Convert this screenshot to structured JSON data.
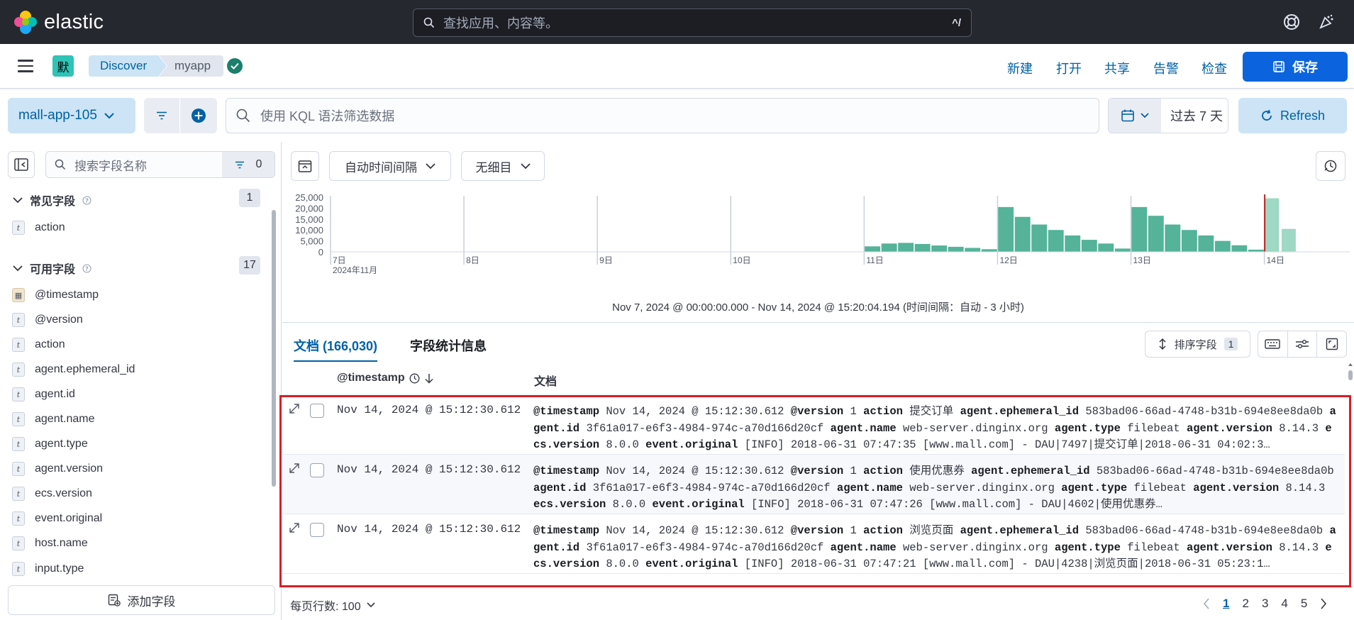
{
  "app": {
    "logo_text": "elastic",
    "search_placeholder": "查找应用、内容等。",
    "search_shortcut": "^/"
  },
  "nav": {
    "space_badge": "默",
    "breadcrumbs": [
      "Discover",
      "myapp"
    ],
    "links": [
      "新建",
      "打开",
      "共享",
      "告警",
      "检查"
    ],
    "save_label": "保存"
  },
  "query": {
    "dataview": "mall-app-105",
    "kql_placeholder": "使用 KQL 语法筛选数据",
    "date_label": "过去 7 天",
    "refresh_label": "Refresh"
  },
  "sidebar": {
    "search_placeholder": "搜索字段名称",
    "filter_count": "0",
    "popular": {
      "title": "常见字段",
      "count": "1",
      "fields": [
        {
          "type": "t",
          "name": "action"
        }
      ]
    },
    "available": {
      "title": "可用字段",
      "count": "17",
      "fields": [
        {
          "type": "date",
          "name": "@timestamp"
        },
        {
          "type": "t",
          "name": "@version"
        },
        {
          "type": "t",
          "name": "action"
        },
        {
          "type": "t",
          "name": "agent.ephemeral_id"
        },
        {
          "type": "t",
          "name": "agent.id"
        },
        {
          "type": "t",
          "name": "agent.name"
        },
        {
          "type": "t",
          "name": "agent.type"
        },
        {
          "type": "t",
          "name": "agent.version"
        },
        {
          "type": "t",
          "name": "ecs.version"
        },
        {
          "type": "t",
          "name": "event.original"
        },
        {
          "type": "t",
          "name": "host.name"
        },
        {
          "type": "t",
          "name": "input.type"
        }
      ]
    },
    "add_field_label": "添加字段"
  },
  "toolbar": {
    "interval": "自动时间间隔",
    "breakdown": "无细目"
  },
  "chart_data": {
    "type": "bar",
    "y_ticks": [
      "25,000",
      "20,000",
      "15,000",
      "10,000",
      "5,000",
      "0"
    ],
    "ylim": [
      0,
      25000
    ],
    "x_ticks": [
      "7日",
      "8日",
      "9日",
      "10日",
      "11日",
      "12日",
      "13日",
      "14日"
    ],
    "x_sublabel": "2024年11月",
    "values": [
      0,
      0,
      0,
      0,
      0,
      0,
      0,
      0,
      0,
      0,
      0,
      0,
      0,
      0,
      0,
      0,
      0,
      0,
      0,
      0,
      0,
      0,
      0,
      0,
      0,
      0,
      0,
      0,
      0,
      0,
      0,
      0,
      2500,
      3800,
      4100,
      3600,
      2900,
      2300,
      1800,
      1200,
      20500,
      16000,
      12500,
      10000,
      7500,
      5500,
      3800,
      1500,
      20500,
      16500,
      12500,
      10000,
      7500,
      5000,
      3000,
      1000,
      24500,
      10500
    ],
    "bar_color": "#54b399"
  },
  "time_range": "Nov 7, 2024 @ 00:00:00.000 - Nov 14, 2024 @ 15:20:04.194  (时间间隔：自动 - 3 小时)",
  "tabs": {
    "docs": "文档 (166,030)",
    "stats": "字段统计信息"
  },
  "sort": {
    "label": "排序字段",
    "count": "1"
  },
  "table": {
    "col_ts": "@timestamp",
    "col_doc": "文档",
    "rows": [
      {
        "ts": "Nov 14, 2024 @ 15:12:30.612",
        "doc": [
          [
            "@timestamp",
            "Nov 14, 2024 @ 15:12:30.612"
          ],
          [
            "@version",
            "1"
          ],
          [
            "action",
            "提交订单"
          ],
          [
            "agent.ephemeral_id",
            "583bad06-66ad-4748-b31b-694e8ee8da0b"
          ],
          [
            "agent.id",
            "3f61a017-e6f3-4984-974c-a70d166d20cf"
          ],
          [
            "agent.name",
            "web-server.dinginx.org"
          ],
          [
            "agent.type",
            "filebeat"
          ],
          [
            "agent.version",
            "8.14.3"
          ],
          [
            "ecs.version",
            "8.0.0"
          ],
          [
            "event.original",
            "[INFO] 2018-06-31 07:47:35 [www.mall.com] - DAU|7497|提交订单|2018-06-31 04:02:3…"
          ]
        ]
      },
      {
        "ts": "Nov 14, 2024 @ 15:12:30.612",
        "doc": [
          [
            "@timestamp",
            "Nov 14, 2024 @ 15:12:30.612"
          ],
          [
            "@version",
            "1"
          ],
          [
            "action",
            "使用优惠券"
          ],
          [
            "agent.ephemeral_id",
            "583bad06-66ad-4748-b31b-694e8ee8da0b"
          ],
          [
            "agent.id",
            "3f61a017-e6f3-4984-974c-a70d166d20cf"
          ],
          [
            "agent.name",
            "web-server.dinginx.org"
          ],
          [
            "agent.type",
            "filebeat"
          ],
          [
            "agent.version",
            "8.14.3"
          ],
          [
            "ecs.version",
            "8.0.0"
          ],
          [
            "event.original",
            "[INFO] 2018-06-31 07:47:26 [www.mall.com] - DAU|4602|使用优惠券…"
          ]
        ]
      },
      {
        "ts": "Nov 14, 2024 @ 15:12:30.612",
        "doc": [
          [
            "@timestamp",
            "Nov 14, 2024 @ 15:12:30.612"
          ],
          [
            "@version",
            "1"
          ],
          [
            "action",
            "浏览页面"
          ],
          [
            "agent.ephemeral_id",
            "583bad06-66ad-4748-b31b-694e8ee8da0b"
          ],
          [
            "agent.id",
            "3f61a017-e6f3-4984-974c-a70d166d20cf"
          ],
          [
            "agent.name",
            "web-server.dinginx.org"
          ],
          [
            "agent.type",
            "filebeat"
          ],
          [
            "agent.version",
            "8.14.3"
          ],
          [
            "ecs.version",
            "8.0.0"
          ],
          [
            "event.original",
            "[INFO] 2018-06-31 07:47:21 [www.mall.com] - DAU|4238|浏览页面|2018-06-31 05:23:1…"
          ]
        ]
      }
    ]
  },
  "footer": {
    "rows_per_page": "每页行数: 100",
    "pages": [
      "1",
      "2",
      "3",
      "4",
      "5"
    ]
  }
}
